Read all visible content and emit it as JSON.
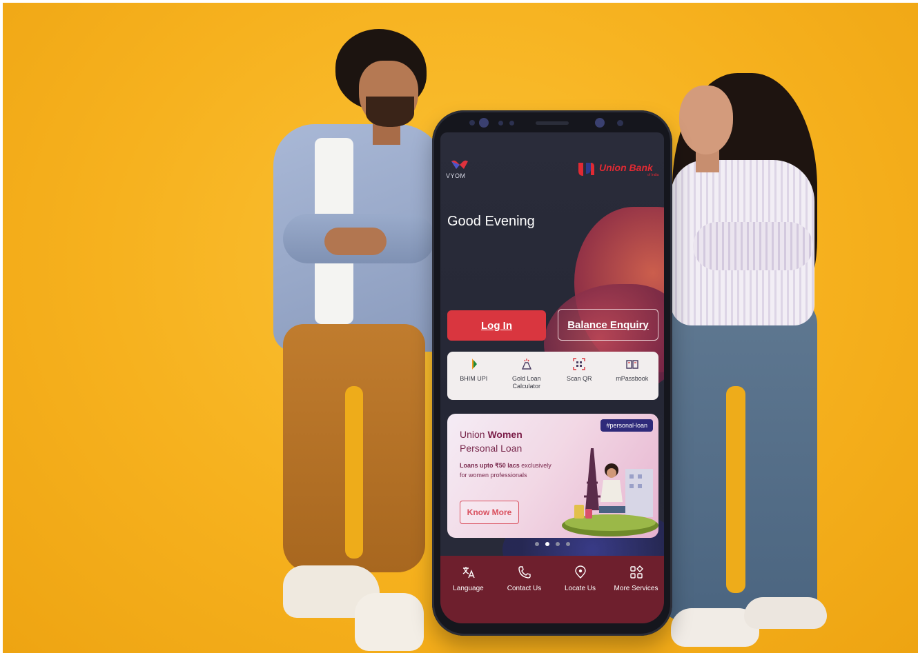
{
  "app": {
    "vyom_logo_text": "VYOM",
    "bank_name": "Union Bank",
    "bank_subtext": "of India"
  },
  "home": {
    "greeting": "Good Evening",
    "login_label": "Log In",
    "balance_label": "Balance Enquiry"
  },
  "quick_actions": [
    {
      "label": "BHIM UPI",
      "icon": "bhim-upi-icon"
    },
    {
      "label": "Gold Loan Calculator",
      "icon": "gold-loan-icon"
    },
    {
      "label": "Scan QR",
      "icon": "qr-scan-icon"
    },
    {
      "label": "mPassbook",
      "icon": "passbook-icon"
    }
  ],
  "banner": {
    "tag": "#personal-loan",
    "title_prefix": "Union ",
    "title_bold": "Women",
    "title_line2": "Personal Loan",
    "desc_bold": "Loans upto ₹50 lacs",
    "desc_rest": " exclusively",
    "desc_line2": "for women professionals",
    "button": "Know More"
  },
  "carousel": {
    "count": 4,
    "active": 1
  },
  "bottom_nav": [
    {
      "label": "Language",
      "icon": "translate-icon"
    },
    {
      "label": "Contact Us",
      "icon": "phone-icon"
    },
    {
      "label": "Locate Us",
      "icon": "location-pin-icon"
    },
    {
      "label": "More Services",
      "icon": "grid-icon"
    }
  ],
  "colors": {
    "background": "#f6b11e",
    "primary_red": "#d9363f",
    "nav_bg": "#6e1f2d",
    "screen_bg": "#252735"
  }
}
